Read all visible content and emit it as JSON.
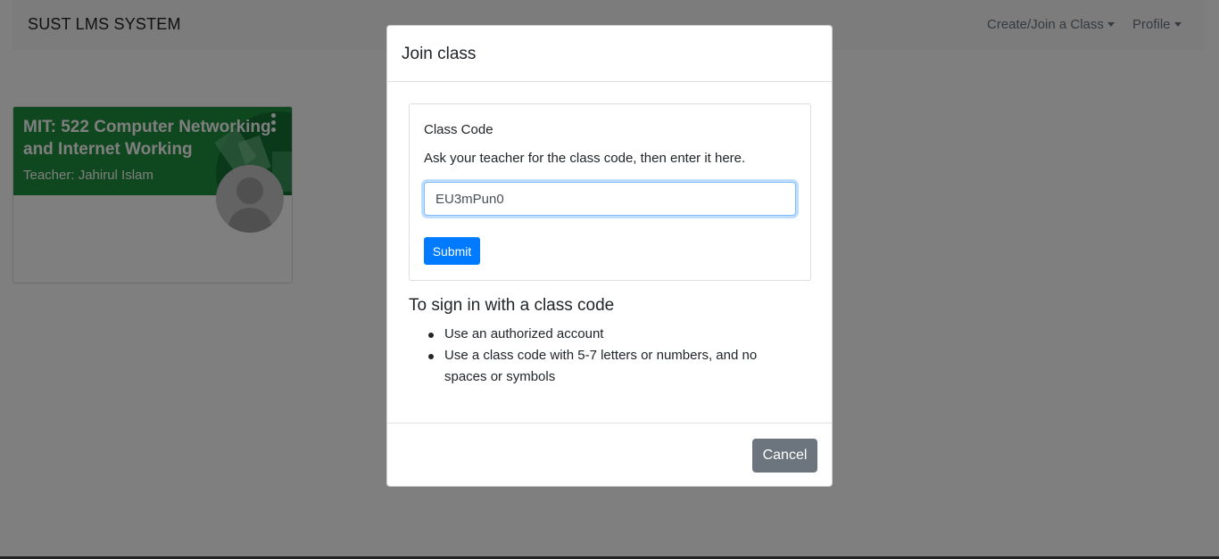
{
  "navbar": {
    "brand": "SUST LMS SYSTEM",
    "create_join_label": "Create/Join a Class",
    "profile_label": "Profile"
  },
  "class_card": {
    "title": "MIT: 522 Computer Networking and Internet Working",
    "teacher": "Teacher: Jahirul Islam",
    "banner_color": "#1e8e3e"
  },
  "modal": {
    "title": "Join class",
    "code_label": "Class Code",
    "code_help": "Ask your teacher for the class code, then enter it here.",
    "code_value": "EU3mPun0",
    "submit_label": "Submit",
    "signin_heading": "To sign in with a class code",
    "signin_items": [
      "Use an authorized account",
      "Use a class code with 5-7 letters or numbers, and no spaces or symbols"
    ],
    "cancel_label": "Cancel"
  },
  "colors": {
    "primary": "#007bff",
    "secondary": "#6c757d"
  }
}
